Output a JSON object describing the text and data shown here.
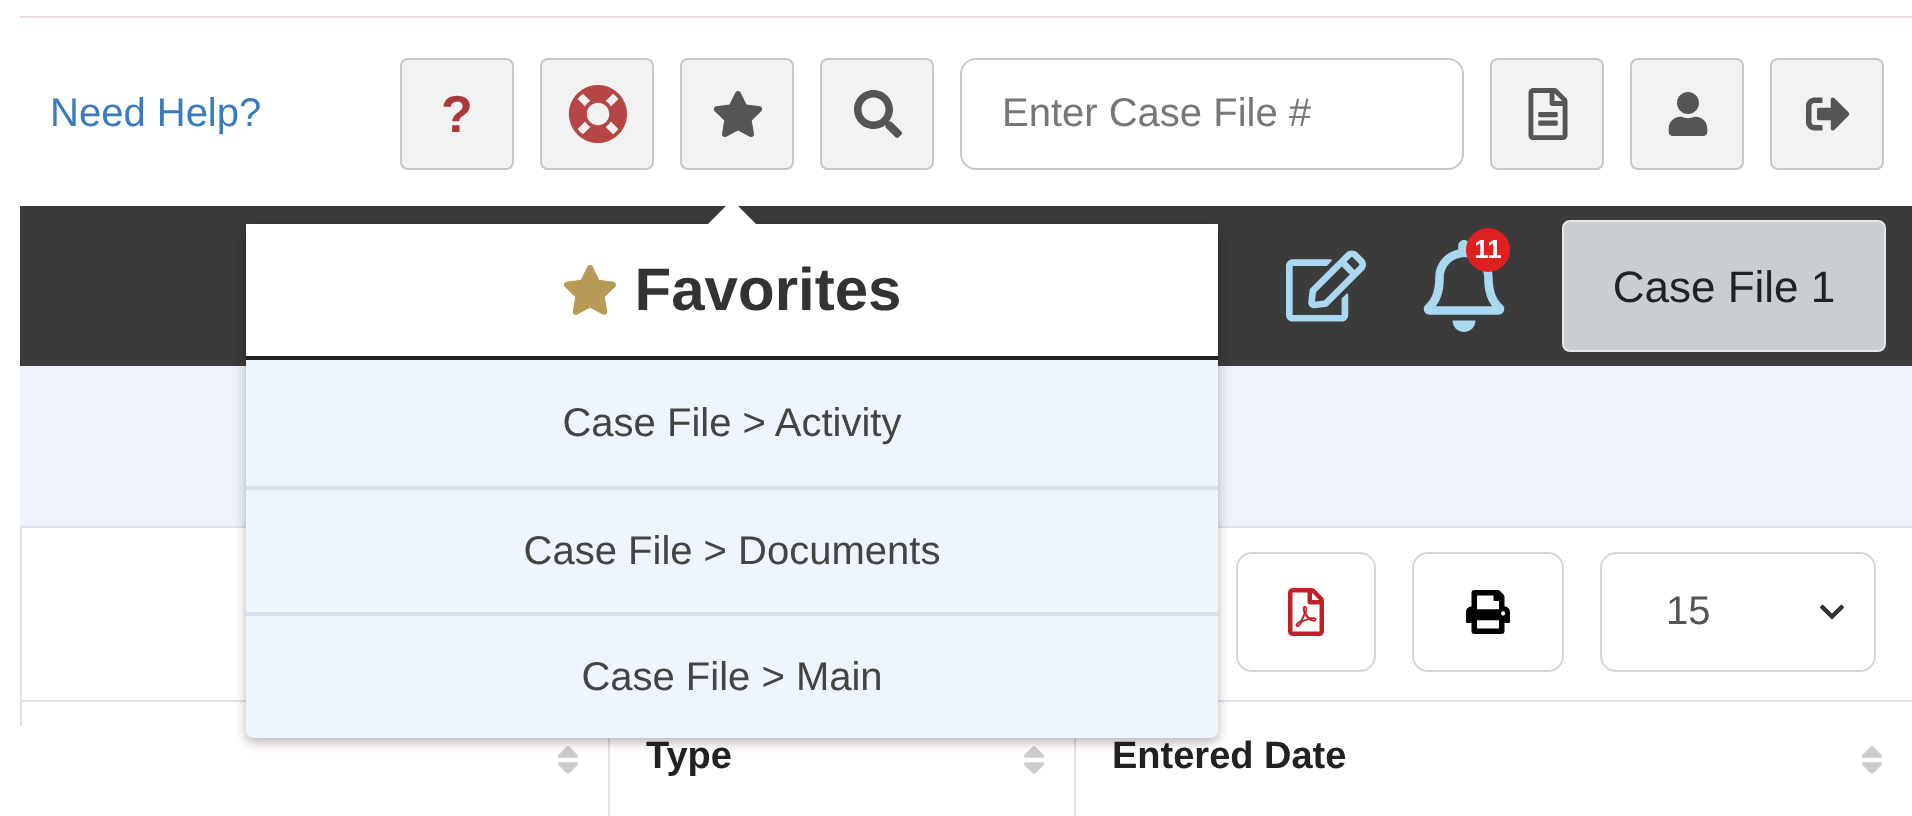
{
  "header": {
    "help_link": "Need Help?",
    "help_button": "?",
    "search": {
      "placeholder": "Enter Case File #"
    }
  },
  "nav": {
    "notifications": {
      "count": "11"
    },
    "case_button": "Case File 1"
  },
  "favorites": {
    "title": "Favorites",
    "items": [
      {
        "label": "Case File > Activity"
      },
      {
        "label": "Case File > Documents"
      },
      {
        "label": "Case File > Main"
      }
    ]
  },
  "table_toolbar": {
    "page_size": "15"
  },
  "table": {
    "columns": [
      {
        "label": "Type"
      },
      {
        "label": "Entered Date"
      }
    ]
  }
}
